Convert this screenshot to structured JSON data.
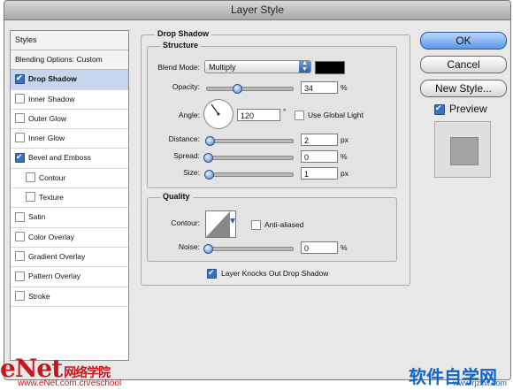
{
  "window": {
    "title": "Layer Style"
  },
  "sidebar": {
    "header": "Styles",
    "items": [
      {
        "label": "Blending Options: Custom",
        "checkbox": false
      },
      {
        "label": "Drop Shadow",
        "checkbox": true,
        "checked": true,
        "selected": true
      },
      {
        "label": "Inner Shadow",
        "checkbox": true,
        "checked": false
      },
      {
        "label": "Outer Glow",
        "checkbox": true,
        "checked": false
      },
      {
        "label": "Inner Glow",
        "checkbox": true,
        "checked": false
      },
      {
        "label": "Bevel and Emboss",
        "checkbox": true,
        "checked": true
      },
      {
        "label": "Contour",
        "checkbox": true,
        "checked": false,
        "indent": true
      },
      {
        "label": "Texture",
        "checkbox": true,
        "checked": false,
        "indent": true
      },
      {
        "label": "Satin",
        "checkbox": true,
        "checked": false
      },
      {
        "label": "Color Overlay",
        "checkbox": true,
        "checked": false
      },
      {
        "label": "Gradient Overlay",
        "checkbox": true,
        "checked": false
      },
      {
        "label": "Pattern Overlay",
        "checkbox": true,
        "checked": false
      },
      {
        "label": "Stroke",
        "checkbox": true,
        "checked": false
      }
    ]
  },
  "panel": {
    "title": "Drop Shadow",
    "structure": {
      "title": "Structure",
      "blend_mode_label": "Blend Mode:",
      "blend_mode_value": "Multiply",
      "shadow_color": "#000000",
      "opacity_label": "Opacity:",
      "opacity_value": "34",
      "opacity_unit": "%",
      "angle_label": "Angle:",
      "angle_value": "120",
      "angle_unit": "°",
      "global_light_label": "Use Global Light",
      "distance_label": "Distance:",
      "distance_value": "2",
      "distance_unit": "px",
      "spread_label": "Spread:",
      "spread_value": "0",
      "spread_unit": "%",
      "size_label": "Size:",
      "size_value": "1",
      "size_unit": "px"
    },
    "quality": {
      "title": "Quality",
      "contour_label": "Contour:",
      "anti_aliased_label": "Anti-aliased",
      "noise_label": "Noise:",
      "noise_value": "0",
      "noise_unit": "%"
    },
    "knockout_label": "Layer Knocks Out Drop Shadow"
  },
  "buttons": {
    "ok": "OK",
    "cancel": "Cancel",
    "new_style": "New Style..."
  },
  "preview": {
    "label": "Preview"
  },
  "watermarks": {
    "left_brand": "eNet",
    "left_cn": "网络学院",
    "left_url": "www.eNet.com.cn/eschool",
    "right_brand": "软件自学网",
    "right_url": "www.rjzxw.com"
  }
}
